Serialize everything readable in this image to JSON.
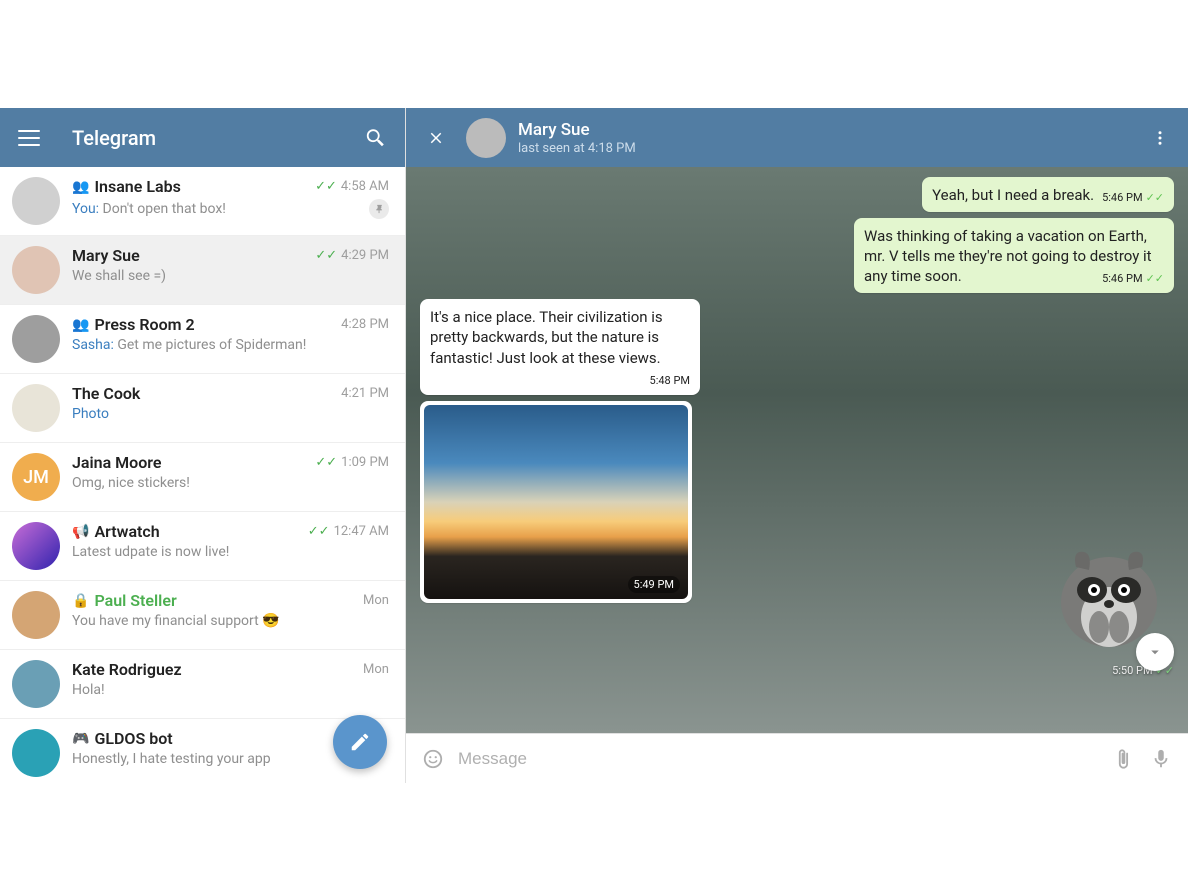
{
  "app": {
    "title": "Telegram"
  },
  "chats": [
    {
      "name": "Insane Labs",
      "prefixIcon": "group",
      "previewYou": "You:",
      "preview": " Don't open that box!",
      "time": "4:58 AM",
      "checks": true,
      "pinned": true,
      "avatarClass": "c1"
    },
    {
      "name": "Mary Sue",
      "preview": "We shall see =)",
      "time": "4:29 PM",
      "checks": true,
      "active": true,
      "avatarClass": "c2"
    },
    {
      "name": "Press Room 2",
      "prefixIcon": "group",
      "previewSender": "Sasha:",
      "preview": " Get me pictures of Spiderman!",
      "time": "4:28 PM",
      "avatarClass": "c3"
    },
    {
      "name": "The Cook",
      "previewMedia": "Photo",
      "time": "4:21 PM",
      "avatarClass": "c4"
    },
    {
      "name": "Jaina Moore",
      "initials": "JM",
      "preview": "Omg, nice stickers!",
      "time": "1:09 PM",
      "checks": true,
      "avatarClass": "c5"
    },
    {
      "name": "Artwatch",
      "prefixIcon": "channel",
      "preview": "Latest udpate is now live!",
      "time": "12:47 AM",
      "checks": true,
      "avatarClass": "c6"
    },
    {
      "name": "Paul Steller",
      "prefixIcon": "lock",
      "secret": true,
      "preview": "You have my financial support 😎",
      "time": "Mon",
      "avatarClass": "c7"
    },
    {
      "name": "Kate Rodriguez",
      "preview": "Hola!",
      "time": "Mon",
      "avatarClass": "c8"
    },
    {
      "name": "GLDOS bot",
      "prefixIcon": "bot",
      "preview": "Honestly, I hate testing your app",
      "time": "",
      "avatarClass": "c9"
    }
  ],
  "conversation": {
    "contactName": "Mary Sue",
    "contactStatus": "last seen at 4:18 PM",
    "messages": {
      "m1": {
        "text": "Yeah, but I need a break.",
        "time": "5:46 PM"
      },
      "m2": {
        "text": "Was thinking of taking a vacation on Earth, mr. V tells me they're not going to destroy it any time soon.",
        "time": "5:46 PM"
      },
      "m3": {
        "text": "It's a nice place. Their civilization is pretty backwards, but the nature is fantastic! Just look at these views.",
        "time": "5:48 PM"
      },
      "photo": {
        "time": "5:49 PM"
      },
      "sticker": {
        "time": "5:50 PM"
      }
    }
  },
  "input": {
    "placeholder": "Message"
  }
}
